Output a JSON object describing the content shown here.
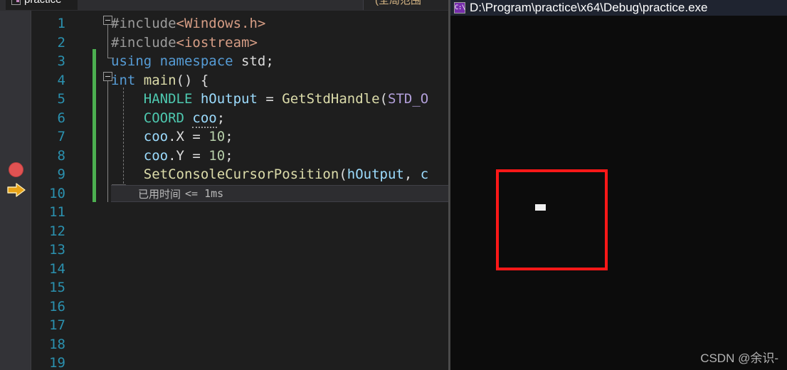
{
  "ide": {
    "tab": {
      "label": "practice",
      "icon": "document-icon"
    },
    "scope_dropdown": {
      "label": "(全局范围",
      "icon": "chevron-down-icon"
    },
    "gutter": {
      "breakpoint_icon": "breakpoint-dot-icon",
      "breakpoint_line": 9,
      "current_statement_icon": "yellow-arrow-icon",
      "current_statement_line": 10
    },
    "datatip": {
      "label": "已用时间",
      "value": "<= 1ms"
    },
    "lines": [
      {
        "n": "1",
        "tokens": [
          {
            "t": "#include",
            "c": "t-pp"
          },
          {
            "t": "<Windows.h>",
            "c": "t-str"
          }
        ]
      },
      {
        "n": "2",
        "tokens": [
          {
            "t": "#include",
            "c": "t-pp"
          },
          {
            "t": "<iostream>",
            "c": "t-str"
          }
        ]
      },
      {
        "n": "3",
        "tokens": [
          {
            "t": "using",
            "c": "t-kw"
          },
          {
            "t": " ",
            "c": "t-plain"
          },
          {
            "t": "namespace",
            "c": "t-kw"
          },
          {
            "t": " std;",
            "c": "t-plain"
          }
        ]
      },
      {
        "n": "4",
        "tokens": [
          {
            "t": "int",
            "c": "t-kw"
          },
          {
            "t": " ",
            "c": "t-plain"
          },
          {
            "t": "main",
            "c": "t-fn"
          },
          {
            "t": "() {",
            "c": "t-punct"
          }
        ]
      },
      {
        "n": "5",
        "tokens": [
          {
            "t": "    ",
            "c": "t-plain"
          },
          {
            "t": "HANDLE",
            "c": "t-type"
          },
          {
            "t": " ",
            "c": "t-plain"
          },
          {
            "t": "hOutput",
            "c": "t-var"
          },
          {
            "t": " = ",
            "c": "t-punct"
          },
          {
            "t": "GetStdHandle",
            "c": "t-fn"
          },
          {
            "t": "(",
            "c": "t-punct"
          },
          {
            "t": "STD_O",
            "c": "t-macro"
          }
        ]
      },
      {
        "n": "6",
        "tokens": [
          {
            "t": "    ",
            "c": "t-plain"
          },
          {
            "t": "COORD",
            "c": "t-type"
          },
          {
            "t": " ",
            "c": "t-plain"
          },
          {
            "t": "coo",
            "c": "t-var squiggle"
          },
          {
            "t": ";",
            "c": "t-punct"
          }
        ]
      },
      {
        "n": "7",
        "tokens": [
          {
            "t": "    ",
            "c": "t-plain"
          },
          {
            "t": "coo",
            "c": "t-var"
          },
          {
            "t": ".X = ",
            "c": "t-punct"
          },
          {
            "t": "10",
            "c": "t-num"
          },
          {
            "t": ";",
            "c": "t-punct"
          }
        ]
      },
      {
        "n": "8",
        "tokens": [
          {
            "t": "    ",
            "c": "t-plain"
          },
          {
            "t": "coo",
            "c": "t-var"
          },
          {
            "t": ".Y = ",
            "c": "t-punct"
          },
          {
            "t": "10",
            "c": "t-num"
          },
          {
            "t": ";",
            "c": "t-punct"
          }
        ]
      },
      {
        "n": "9",
        "tokens": [
          {
            "t": "    ",
            "c": "t-plain"
          },
          {
            "t": "SetConsoleCursorPosition",
            "c": "t-fn"
          },
          {
            "t": "(",
            "c": "t-punct"
          },
          {
            "t": "hOutput",
            "c": "t-var"
          },
          {
            "t": ", ",
            "c": "t-punct"
          },
          {
            "t": "c",
            "c": "t-var"
          }
        ]
      },
      {
        "n": "10",
        "tokens": []
      },
      {
        "n": "11",
        "tokens": []
      },
      {
        "n": "12",
        "tokens": []
      },
      {
        "n": "13",
        "tokens": []
      },
      {
        "n": "14",
        "tokens": []
      },
      {
        "n": "15",
        "tokens": []
      },
      {
        "n": "16",
        "tokens": []
      },
      {
        "n": "17",
        "tokens": []
      },
      {
        "n": "18",
        "tokens": []
      },
      {
        "n": "19",
        "tokens": []
      }
    ],
    "closing_brace": "}"
  },
  "console": {
    "title": "D:\\Program\\practice\\x64\\Debug\\practice.exe",
    "icon": "cmd-console-icon",
    "icon_text": "C:\\",
    "red_box": {
      "color": "#ff1818"
    },
    "cursor_block": {
      "color": "#f0f0f0"
    },
    "watermark": "CSDN @余识-"
  }
}
